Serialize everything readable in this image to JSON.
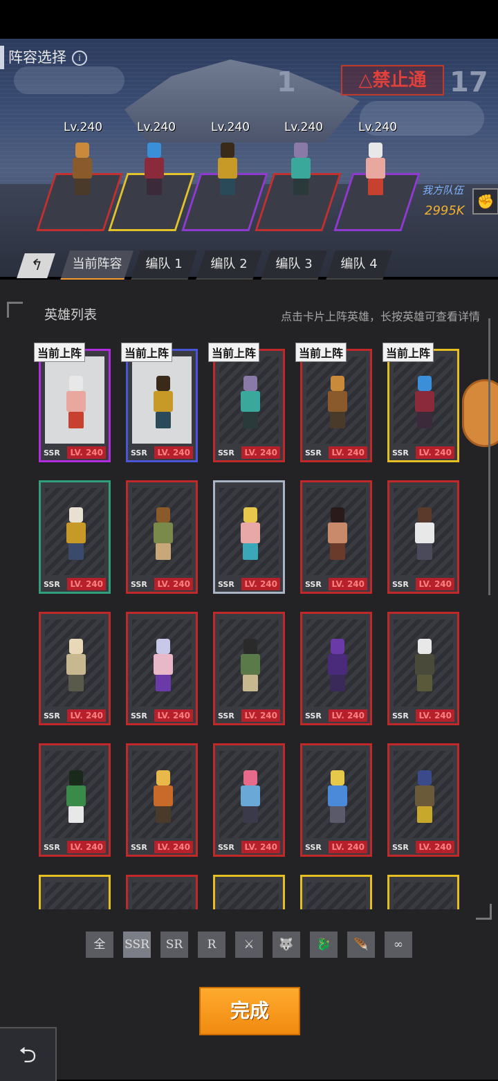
{
  "header": {
    "title": "阵容选择",
    "info_icon": "i"
  },
  "scene": {
    "warning_sign": "△禁止通",
    "levels": [
      "Lv.240",
      "Lv.240",
      "Lv.240",
      "Lv.240",
      "Lv.240"
    ],
    "team_label": "我方队伍",
    "power": "2995K"
  },
  "tabs": [
    "当前阵容",
    "编队 1",
    "编队 2",
    "编队 3",
    "编队 4"
  ],
  "list": {
    "title": "英雄列表",
    "hint": "点击卡片上阵英雄，长按英雄可查看详情"
  },
  "cards": {
    "badge": "当前上阵",
    "rarity": "SSR",
    "level": "LV. 240"
  },
  "filters": [
    "全",
    "SSR",
    "SR",
    "R",
    "⚔",
    "🐺",
    "🐉",
    "🪶",
    "∞"
  ],
  "buttons": {
    "done": "完成",
    "back": "⮌"
  },
  "colors": {
    "accent": "#f39c2a",
    "ssr_border": "#c0282a",
    "gold_border": "#e6c023"
  }
}
